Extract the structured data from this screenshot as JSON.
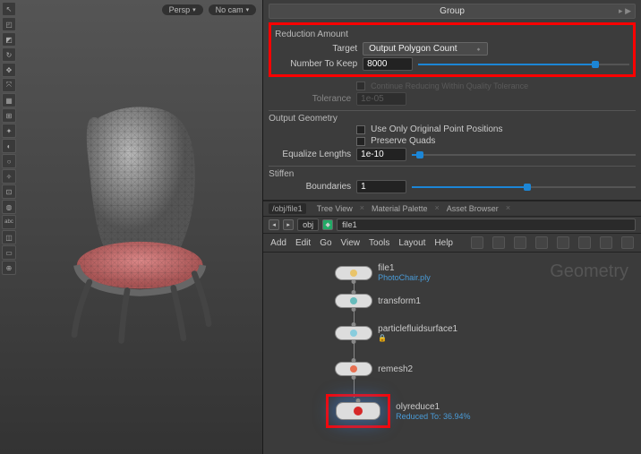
{
  "viewport": {
    "persp_tag": "Persp",
    "cam_tag": "No cam",
    "left_icons": [
      "↖",
      "◰",
      "◩",
      "↻",
      "✥",
      "⤧",
      "▦",
      "⊞",
      "✦",
      "◐",
      "○",
      "✧",
      "⊡",
      "◍",
      "abc",
      "◫",
      "▭",
      "⊕"
    ]
  },
  "params": {
    "group_header": "Group",
    "reduction_section": "Reduction Amount",
    "target_label": "Target",
    "target_value": "Output Polygon Count",
    "number_label": "Number To Keep",
    "number_value": "8000",
    "continue_checkbox": "Continue Reducing Within Quality Tolerance",
    "tolerance_label": "Tolerance",
    "tolerance_value": "1e-05",
    "output_section": "Output Geometry",
    "orig_points": "Use Only Original Point Positions",
    "preserve_quads": "Preserve Quads",
    "equalize_label": "Equalize Lengths",
    "equalize_value": "1e-10",
    "stiffen_section": "Stiffen",
    "boundaries_label": "Boundaries",
    "boundaries_value": "1"
  },
  "network": {
    "crumb": "/obj/file1",
    "tabs": [
      "Tree View",
      "Material Palette",
      "Asset Browser"
    ],
    "path_ctx": "obj",
    "path_node": "file1",
    "menu": [
      "Add",
      "Edit",
      "Go",
      "View",
      "Tools",
      "Layout",
      "Help"
    ],
    "geometry_label": "Geometry",
    "nodes": {
      "file1": {
        "label": "file1",
        "sublabel": "PhotoChair.ply"
      },
      "transform1": {
        "label": "transform1"
      },
      "pfs1": {
        "label": "particlefluidsurface1"
      },
      "remesh2": {
        "label": "remesh2"
      },
      "polyreduce1": {
        "label": "olyreduce1",
        "sublabel": "Reduced To: 36.94%"
      }
    }
  }
}
